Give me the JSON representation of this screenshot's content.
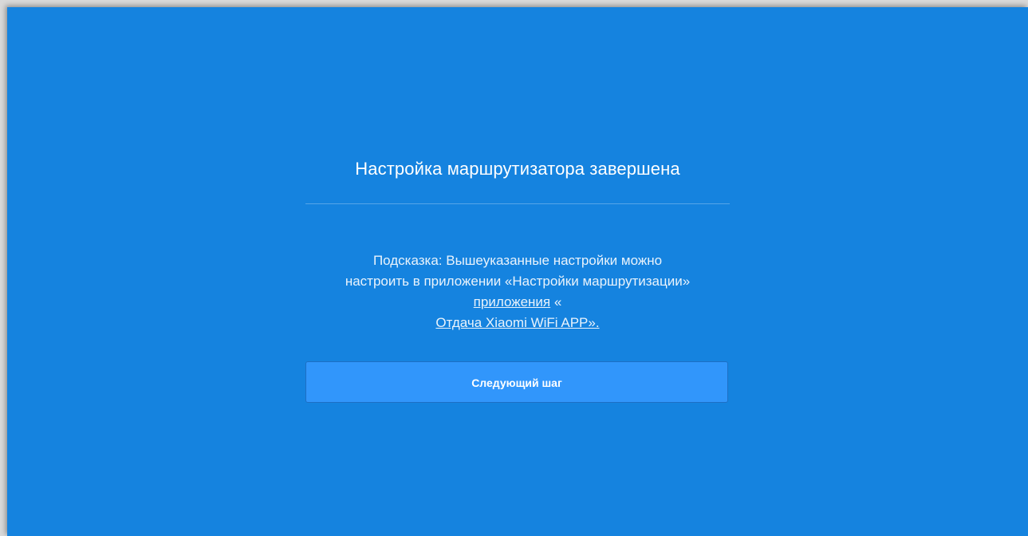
{
  "page": {
    "title": "Настройка маршрутизатора завершена",
    "hint": {
      "line1": "Подсказка: Вышеуказанные настройки можно",
      "line2": "настроить в приложении «Настройки маршрутизации»",
      "link1_label": "приложения",
      "line3_suffix": " «",
      "link2_label": "Отдача Xiaomi WiFi APP»."
    },
    "next_button_label": "Следующий шаг"
  },
  "colors": {
    "background": "#1583df",
    "button": "#3196fb",
    "text": "#ffffff"
  }
}
